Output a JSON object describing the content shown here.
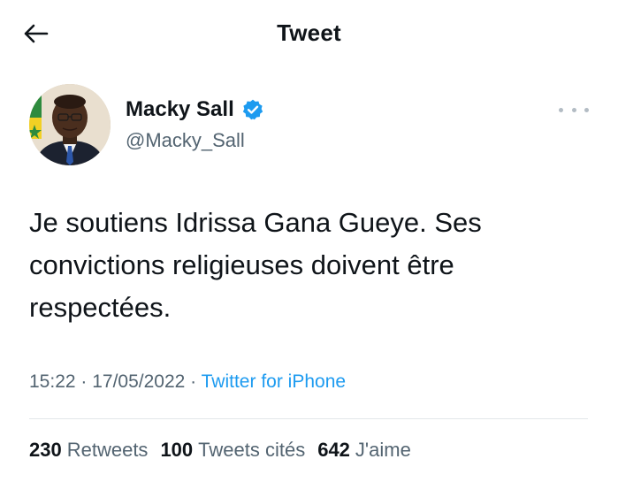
{
  "header": {
    "title": "Tweet",
    "back_icon": "arrow-left-icon"
  },
  "author": {
    "name": "Macky Sall",
    "handle": "@Macky_Sall",
    "verified_icon": "verified-badge-icon",
    "avatar": "profile-photo"
  },
  "menu": {
    "icon": "more-options-icon"
  },
  "tweet": {
    "text": "Je soutiens Idrissa Gana Gueye. Ses convictions religieuses doivent être respectées.",
    "time": "15:22",
    "separator": " · ",
    "date": "17/05/2022",
    "source": "Twitter for iPhone"
  },
  "stats": {
    "retweets_count": "230",
    "retweets_label": "Retweets",
    "quotes_count": "100",
    "quotes_label": "Tweets cités",
    "likes_count": "642",
    "likes_label": "J'aime"
  },
  "colors": {
    "link": "#1d9bf0",
    "secondary_text": "#536471",
    "primary_text": "#0f1419"
  }
}
